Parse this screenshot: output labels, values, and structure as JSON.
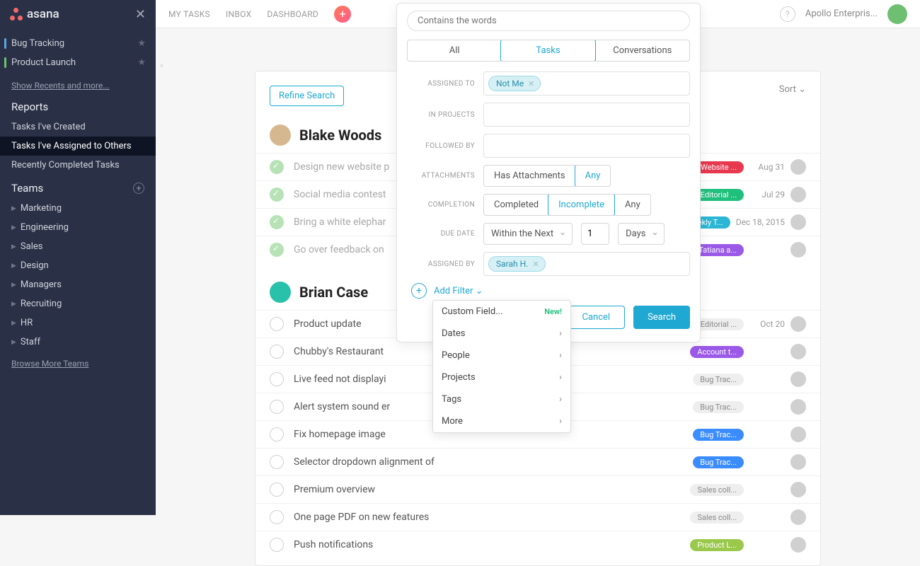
{
  "brand": "asana",
  "sidebar": {
    "projects": [
      {
        "label": "Bug Tracking",
        "color": "blue"
      },
      {
        "label": "Product Launch",
        "color": "green"
      }
    ],
    "recents_link": "Show Recents and more...",
    "reports_title": "Reports",
    "reports": [
      {
        "label": "Tasks I've Created",
        "active": false
      },
      {
        "label": "Tasks I've Assigned to Others",
        "active": true
      },
      {
        "label": "Recently Completed Tasks",
        "active": false
      }
    ],
    "teams_title": "Teams",
    "teams": [
      "Marketing",
      "Engineering",
      "Sales",
      "Design",
      "Managers",
      "Recruiting",
      "HR",
      "Staff"
    ],
    "browse_link": "Browse More Teams"
  },
  "topnav": {
    "mytasks": "MY TASKS",
    "inbox": "INBOX",
    "dashboard": "DASHBOARD"
  },
  "topright": {
    "workspace": "Apollo Enterpris..."
  },
  "panel": {
    "refine": "Refine Search",
    "sort": "Sort ⌄"
  },
  "groups": [
    {
      "name": "Blake Woods",
      "tasks": [
        {
          "title": "Design new website p",
          "done": true,
          "tags": [
            {
              "text": "Website ...",
              "color": "red"
            }
          ],
          "date": "Aug 31"
        },
        {
          "title": "Social media contest",
          "done": true,
          "tags": [
            {
              "text": "Editorial ...",
              "color": "green"
            }
          ],
          "date": "Jul 29"
        },
        {
          "title": "Bring a white elephar",
          "done": true,
          "tags": [
            {
              "text": "eekly T...",
              "color": "teal"
            }
          ],
          "date": "Dec 18, 2015"
        },
        {
          "title": "Go over feedback on",
          "done": true,
          "tags": [
            {
              "text": "Tatiana a...",
              "color": "purple"
            }
          ],
          "date": ""
        }
      ]
    },
    {
      "name": "Brian Case",
      "tasks": [
        {
          "title": "Product update",
          "done": false,
          "tags": [
            {
              "text": "Editorial ...",
              "color": "grey"
            }
          ],
          "date": "Oct 20"
        },
        {
          "title": "Chubby's Restaurant",
          "done": false,
          "tags": [
            {
              "text": "Account t...",
              "color": "purple"
            }
          ],
          "date": ""
        },
        {
          "title": "Live feed not displayi",
          "done": false,
          "tags": [
            {
              "text": "Bug Trac...",
              "color": "grey"
            }
          ],
          "date": ""
        },
        {
          "title": "Alert system sound er",
          "done": false,
          "tags": [
            {
              "text": "Bug Trac...",
              "color": "grey"
            }
          ],
          "date": ""
        },
        {
          "title": "Fix homepage image",
          "done": false,
          "tags": [
            {
              "text": "Bug Trac...",
              "color": "blue"
            }
          ],
          "date": ""
        },
        {
          "title": "Selector dropdown alignment of",
          "done": false,
          "tags": [
            {
              "text": "Bug Trac...",
              "color": "blue"
            }
          ],
          "date": ""
        },
        {
          "title": "Premium overview",
          "done": false,
          "tags": [
            {
              "text": "Sales coll...",
              "color": "grey"
            }
          ],
          "date": ""
        },
        {
          "title": "One page PDF on new features",
          "done": false,
          "tags": [
            {
              "text": "Sales coll...",
              "color": "grey"
            }
          ],
          "date": ""
        },
        {
          "title": "Push notifications",
          "done": false,
          "tags": [
            {
              "text": "Product L...",
              "color": "lime"
            }
          ],
          "date": ""
        }
      ]
    }
  ],
  "search": {
    "placeholder": "Contains the words",
    "segments": {
      "all": "All",
      "tasks": "Tasks",
      "conv": "Conversations"
    },
    "labels": {
      "assigned_to": "ASSIGNED TO",
      "in_projects": "IN PROJECTS",
      "followed_by": "FOLLOWED BY",
      "attachments": "ATTACHMENTS",
      "completion": "COMPLETION",
      "due_date": "DUE DATE",
      "assigned_by": "ASSIGNED BY"
    },
    "tokens": {
      "not_me": "Not Me",
      "sarah": "Sarah H."
    },
    "attach": {
      "has": "Has Attachments",
      "any": "Any"
    },
    "completion": {
      "completed": "Completed",
      "incomplete": "Incomplete",
      "any": "Any"
    },
    "due": {
      "range": "Within the Next",
      "value": "1",
      "unit": "Days"
    },
    "add_filter": "Add Filter ⌄",
    "menu": [
      {
        "label": "Custom Field...",
        "badge": "New!"
      },
      {
        "label": "Dates",
        "chev": true
      },
      {
        "label": "People",
        "chev": true
      },
      {
        "label": "Projects",
        "chev": true
      },
      {
        "label": "Tags",
        "chev": true
      },
      {
        "label": "More",
        "chev": true
      }
    ],
    "buttons": {
      "cancel": "Cancel",
      "search": "Search"
    }
  }
}
